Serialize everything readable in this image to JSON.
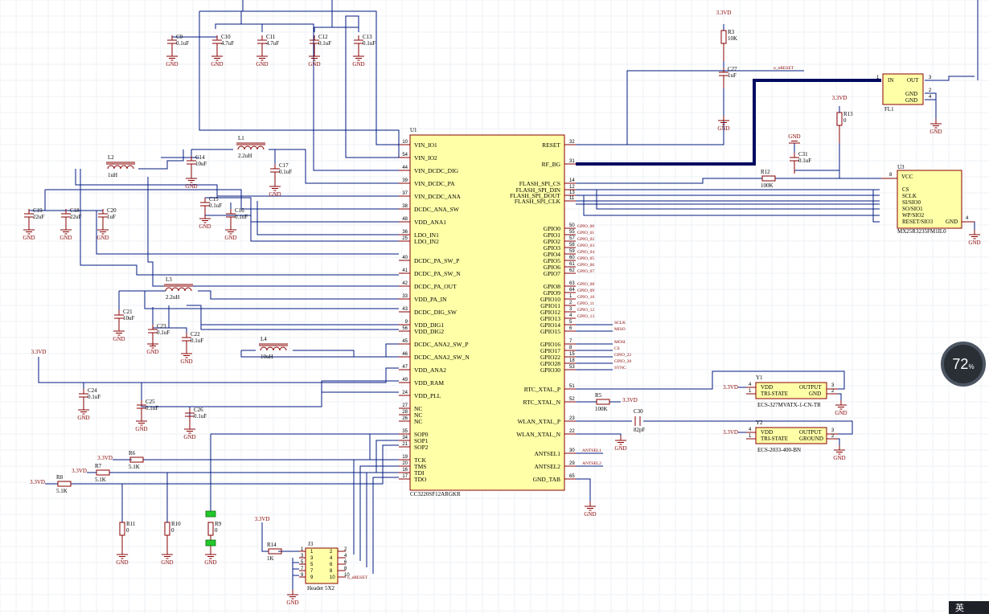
{
  "u1": {
    "ref": "U1",
    "part": "CC3220SF12ARGKR",
    "left_pins": [
      {
        "num": "10",
        "name": "VIN_IO1"
      },
      {
        "num": "54",
        "name": "VIN_IO2"
      },
      {
        "num": "44",
        "name": "VIN_DCDC_DIG"
      },
      {
        "num": "39",
        "name": "VIN_DCDC_PA"
      },
      {
        "num": "37",
        "name": "VIN_DCDC_ANA"
      },
      {
        "num": "38",
        "name": "DCDC_ANA_SW"
      },
      {
        "num": "48",
        "name": "VDD_ANA1"
      },
      {
        "num": "36",
        "name": "LDO_IN1"
      },
      {
        "num": "25",
        "name": "LDO_IN2"
      },
      {
        "num": "40",
        "name": "DCDC_PA_SW_P"
      },
      {
        "num": "41",
        "name": "DCDC_PA_SW_N"
      },
      {
        "num": "42",
        "name": "DCDC_PA_OUT"
      },
      {
        "num": "33",
        "name": "VDD_PA_IN"
      },
      {
        "num": "43",
        "name": "DCDC_DIG_SW"
      },
      {
        "num": "9",
        "name": "VDD_DIG1"
      },
      {
        "num": "56",
        "name": "VDD_DIG2"
      },
      {
        "num": "45",
        "name": "DCDC_ANA2_SW_P"
      },
      {
        "num": "46",
        "name": "DCDC_ANA2_SW_N"
      },
      {
        "num": "47",
        "name": "VDD_ANA2"
      },
      {
        "num": "49",
        "name": "VDD_RAM"
      },
      {
        "num": "24",
        "name": "VDD_PLL"
      },
      {
        "num": "27",
        "name": "NC"
      },
      {
        "num": "28",
        "name": "NC"
      },
      {
        "num": "26",
        "name": "NC"
      },
      {
        "num": "35",
        "name": "SOP0"
      },
      {
        "num": "34",
        "name": "SOP1"
      },
      {
        "num": "21",
        "name": "SOP2"
      },
      {
        "num": "19",
        "name": "TCK"
      },
      {
        "num": "20",
        "name": "TMS"
      },
      {
        "num": "16",
        "name": "TDI"
      },
      {
        "num": "17",
        "name": "TDO"
      }
    ],
    "right_pins": [
      {
        "num": "32",
        "name": "RESET"
      },
      {
        "num": "31",
        "name": "RF_BG"
      },
      {
        "num": "14",
        "name": "FLASH_SPI_CS"
      },
      {
        "num": "12",
        "name": "FLASH_SPI_DIN"
      },
      {
        "num": "13",
        "name": "FLASH_SPI_DOUT"
      },
      {
        "num": "11",
        "name": "FLASH_SPI_CLK"
      },
      {
        "num": "50",
        "name": "GPIO0"
      },
      {
        "num": "55",
        "name": "GPIO1"
      },
      {
        "num": "57",
        "name": "GPIO2"
      },
      {
        "num": "58",
        "name": "GPIO3"
      },
      {
        "num": "59",
        "name": "GPIO4"
      },
      {
        "num": "60",
        "name": "GPIO5"
      },
      {
        "num": "61",
        "name": "GPIO6"
      },
      {
        "num": "62",
        "name": "GPIO7"
      },
      {
        "num": "63",
        "name": "GPIO8"
      },
      {
        "num": "64",
        "name": "GPIO9"
      },
      {
        "num": "1",
        "name": "GPIO10"
      },
      {
        "num": "2",
        "name": "GPIO11"
      },
      {
        "num": "3",
        "name": "GPIO12"
      },
      {
        "num": "4",
        "name": "GPIO13"
      },
      {
        "num": "5",
        "name": "GPIO14"
      },
      {
        "num": "6",
        "name": "GPIO15"
      },
      {
        "num": "7",
        "name": "GPIO16"
      },
      {
        "num": "8",
        "name": "GPIO17"
      },
      {
        "num": "15",
        "name": "GPIO22"
      },
      {
        "num": "18",
        "name": "GPIO28"
      },
      {
        "num": "53",
        "name": "GPIO30"
      },
      {
        "num": "51",
        "name": "RTC_XTAL_P"
      },
      {
        "num": "52",
        "name": "RTC_XTAL_N"
      },
      {
        "num": "23",
        "name": "WLAN_XTAL_P"
      },
      {
        "num": "22",
        "name": "WLAN_XTAL_N"
      },
      {
        "num": "30",
        "name": "ANTSEL1"
      },
      {
        "num": "29",
        "name": "ANTSEL2"
      },
      {
        "num": "65",
        "name": "GND_TAB"
      }
    ]
  },
  "net_labels": {
    "gpio": [
      "GPIO_00",
      "GPIO_01",
      "GPIO_02",
      "GPIO_03",
      "GPIO_04",
      "GPIO_05",
      "GPIO_06",
      "GPIO_07",
      "GPIO_08",
      "GPIO_09",
      "GPIO_10",
      "GPIO_11",
      "GPIO_12",
      "GPIO_13",
      "SCLK",
      "MISO",
      "MOSI",
      "CS",
      "GPIO_22",
      "GPIO_28",
      "SYNC"
    ],
    "reset": "n_nRESET",
    "antsel1": "ANTSEL1",
    "antsel2": "ANTSEL2"
  },
  "capacitors": [
    {
      "ref": "C9",
      "value": "0.1uF"
    },
    {
      "ref": "C10",
      "value": "4.7uF"
    },
    {
      "ref": "C11",
      "value": "4.7uF"
    },
    {
      "ref": "C12",
      "value": "0.1uF"
    },
    {
      "ref": "C13",
      "value": "0.1uF"
    },
    {
      "ref": "C14",
      "value": "10uF"
    },
    {
      "ref": "C15",
      "value": "0.1uF"
    },
    {
      "ref": "C16",
      "value": "0.1uF"
    },
    {
      "ref": "C17",
      "value": "0.1uF"
    },
    {
      "ref": "C18",
      "value": "22uF"
    },
    {
      "ref": "C19",
      "value": "22uF"
    },
    {
      "ref": "C20",
      "value": "1uF"
    },
    {
      "ref": "C21",
      "value": "10uF"
    },
    {
      "ref": "C22",
      "value": "0.1uF"
    },
    {
      "ref": "C23",
      "value": "0.1uF"
    },
    {
      "ref": "C24",
      "value": "0.1uF"
    },
    {
      "ref": "C25",
      "value": "0.1uF"
    },
    {
      "ref": "C26",
      "value": "0.1uF"
    },
    {
      "ref": "C27",
      "value": "1uF"
    },
    {
      "ref": "C30",
      "value": "82pF"
    },
    {
      "ref": "C31",
      "value": "0.1uF"
    }
  ],
  "inductors": [
    {
      "ref": "L1",
      "value": "2.2uH"
    },
    {
      "ref": "L2",
      "value": "1uH"
    },
    {
      "ref": "L3",
      "value": "2.2uH"
    },
    {
      "ref": "L4",
      "value": "10uH"
    }
  ],
  "resistors": [
    {
      "ref": "R3",
      "value": "10K"
    },
    {
      "ref": "R5",
      "value": "100K"
    },
    {
      "ref": "R6",
      "value": "5.1K"
    },
    {
      "ref": "R7",
      "value": "5.1K"
    },
    {
      "ref": "R8",
      "value": "5.1K"
    },
    {
      "ref": "R9",
      "value": "0"
    },
    {
      "ref": "R10",
      "value": "0"
    },
    {
      "ref": "R11",
      "value": "0"
    },
    {
      "ref": "R12",
      "value": "100K"
    },
    {
      "ref": "R13",
      "value": "0"
    },
    {
      "ref": "R14",
      "value": "1K"
    }
  ],
  "power": {
    "gnd": "GND",
    "v33": "3.3VD"
  },
  "y1": {
    "ref": "Y1",
    "part": "ECS-327MVATX-1-CN-TR",
    "vdd": "VDD",
    "tri": "TRI-STATE",
    "out": "OUTPUT",
    "gnd": "GND"
  },
  "y2": {
    "ref": "Y2",
    "part": "ECS-2033-400-BN",
    "vdd": "VDD",
    "tri": "TRI-STATE",
    "out": "OUTPUT",
    "gnd": "GROUND"
  },
  "u3": {
    "ref": "U3",
    "part": "MX25R3235FM1IL0",
    "vcc": "VCC",
    "gnd": "GND",
    "pins": [
      "CS",
      "SCLK",
      "SI/SIO0",
      "SO/SIO1",
      "WP/SIO2",
      "RESET/SIO3"
    ]
  },
  "fl1": {
    "ref": "FL1",
    "in": "IN",
    "out": "OUT",
    "gnd": "GND"
  },
  "j3": {
    "ref": "J3",
    "part": "Header 5X2"
  },
  "zoom": {
    "value": "72",
    "unit": "%"
  },
  "ime": {
    "label": "英"
  }
}
